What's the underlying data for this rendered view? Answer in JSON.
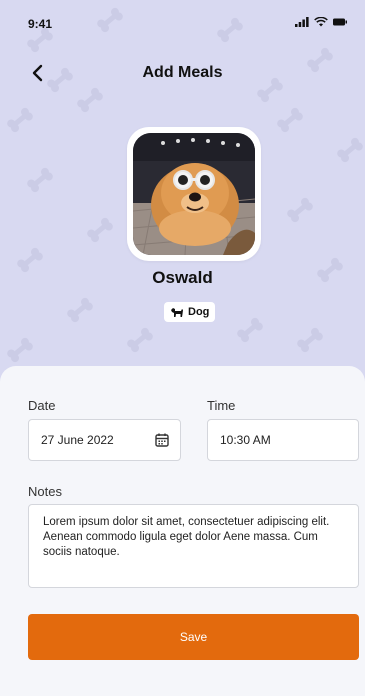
{
  "status_bar": {
    "time": "9:41"
  },
  "header": {
    "title": "Add Meals"
  },
  "pet": {
    "name": "Oswald",
    "type": "Dog"
  },
  "form": {
    "date_label": "Date",
    "date_value": "27 June 2022",
    "time_label": "Time",
    "time_value": "10:30 AM",
    "notes_label": "Notes",
    "notes_value": "Lorem ipsum dolor sit amet, consectetuer adipiscing elit. Aenean commodo ligula eget dolor Aene massa. Cum sociis natoque."
  },
  "actions": {
    "save_label": "Save"
  },
  "colors": {
    "accent": "#e36a0d",
    "hero_bg": "#d8d9f1",
    "sheet_bg": "#f5f6fa"
  }
}
